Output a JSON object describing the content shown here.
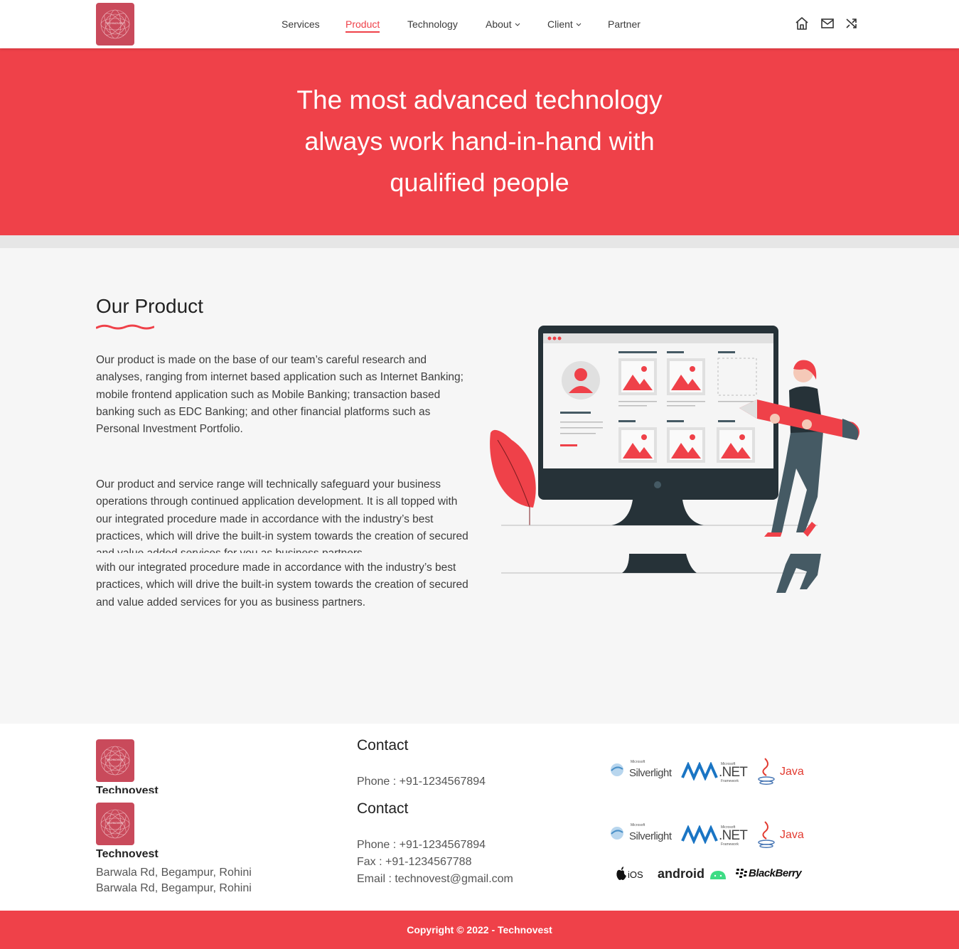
{
  "brand": {
    "logo_text": "TECHNOVEST",
    "name": "Technovest"
  },
  "nav": {
    "items": [
      {
        "label": "Services",
        "active": false,
        "dropdown": false
      },
      {
        "label": "Product",
        "active": true,
        "dropdown": false
      },
      {
        "label": "Technology",
        "active": false,
        "dropdown": false
      },
      {
        "label": "About",
        "active": false,
        "dropdown": true
      },
      {
        "label": "Client",
        "active": false,
        "dropdown": true
      },
      {
        "label": "Partner",
        "active": false,
        "dropdown": false
      }
    ],
    "icons": [
      "home-icon",
      "mail-icon",
      "shuffle-icon"
    ]
  },
  "hero": {
    "line1": "The most advanced technology",
    "line2": "always work hand-in-hand with",
    "line3": "qualified people"
  },
  "product": {
    "title": "Our Product",
    "para1": "Our product is made on the base of our team’s careful research and analyses, ranging from internet based application such as Internet Banking; mobile frontend application such as Mobile Banking; transaction based banking such as EDC Banking; and other financial platforms such as Personal Investment Portfolio.",
    "para2": "Our product and service range will technically safeguard your business operations through continued application development. It is all topped with our integrated procedure made in accordance with the industry’s best practices, which will drive the built-in system towards the creation of secured and value added services for you as business partners.",
    "para3": "with our integrated procedure made in accordance with the industry’s best practices, which will drive the built-in system towards the creation of secured and value added services for you as business partners."
  },
  "footer": {
    "company": "Technovest",
    "address": "Barwala Rd, Begampur, Rohini",
    "contact_title": "Contact",
    "phone": "Phone : +91-1234567894",
    "fax": "Fax : +91-1234567788",
    "email": "Email : technovest@gmail.com",
    "tech_logos": {
      "silverlight": "Silverlight",
      "silverlight_small": "Microsoft",
      "dotnet": ".NET",
      "dotnet_small": "Microsoft",
      "dotnet_sub": "Framework",
      "java": "Java",
      "ios": "iOS",
      "android": "android",
      "blackberry": "BlackBerry"
    },
    "copyright": "Copyright © 2022 - Technovest"
  },
  "colors": {
    "accent": "#ef4149",
    "logo_bg": "#c94a5b",
    "main_bg": "#f6f6f6",
    "dark": "#263238"
  }
}
